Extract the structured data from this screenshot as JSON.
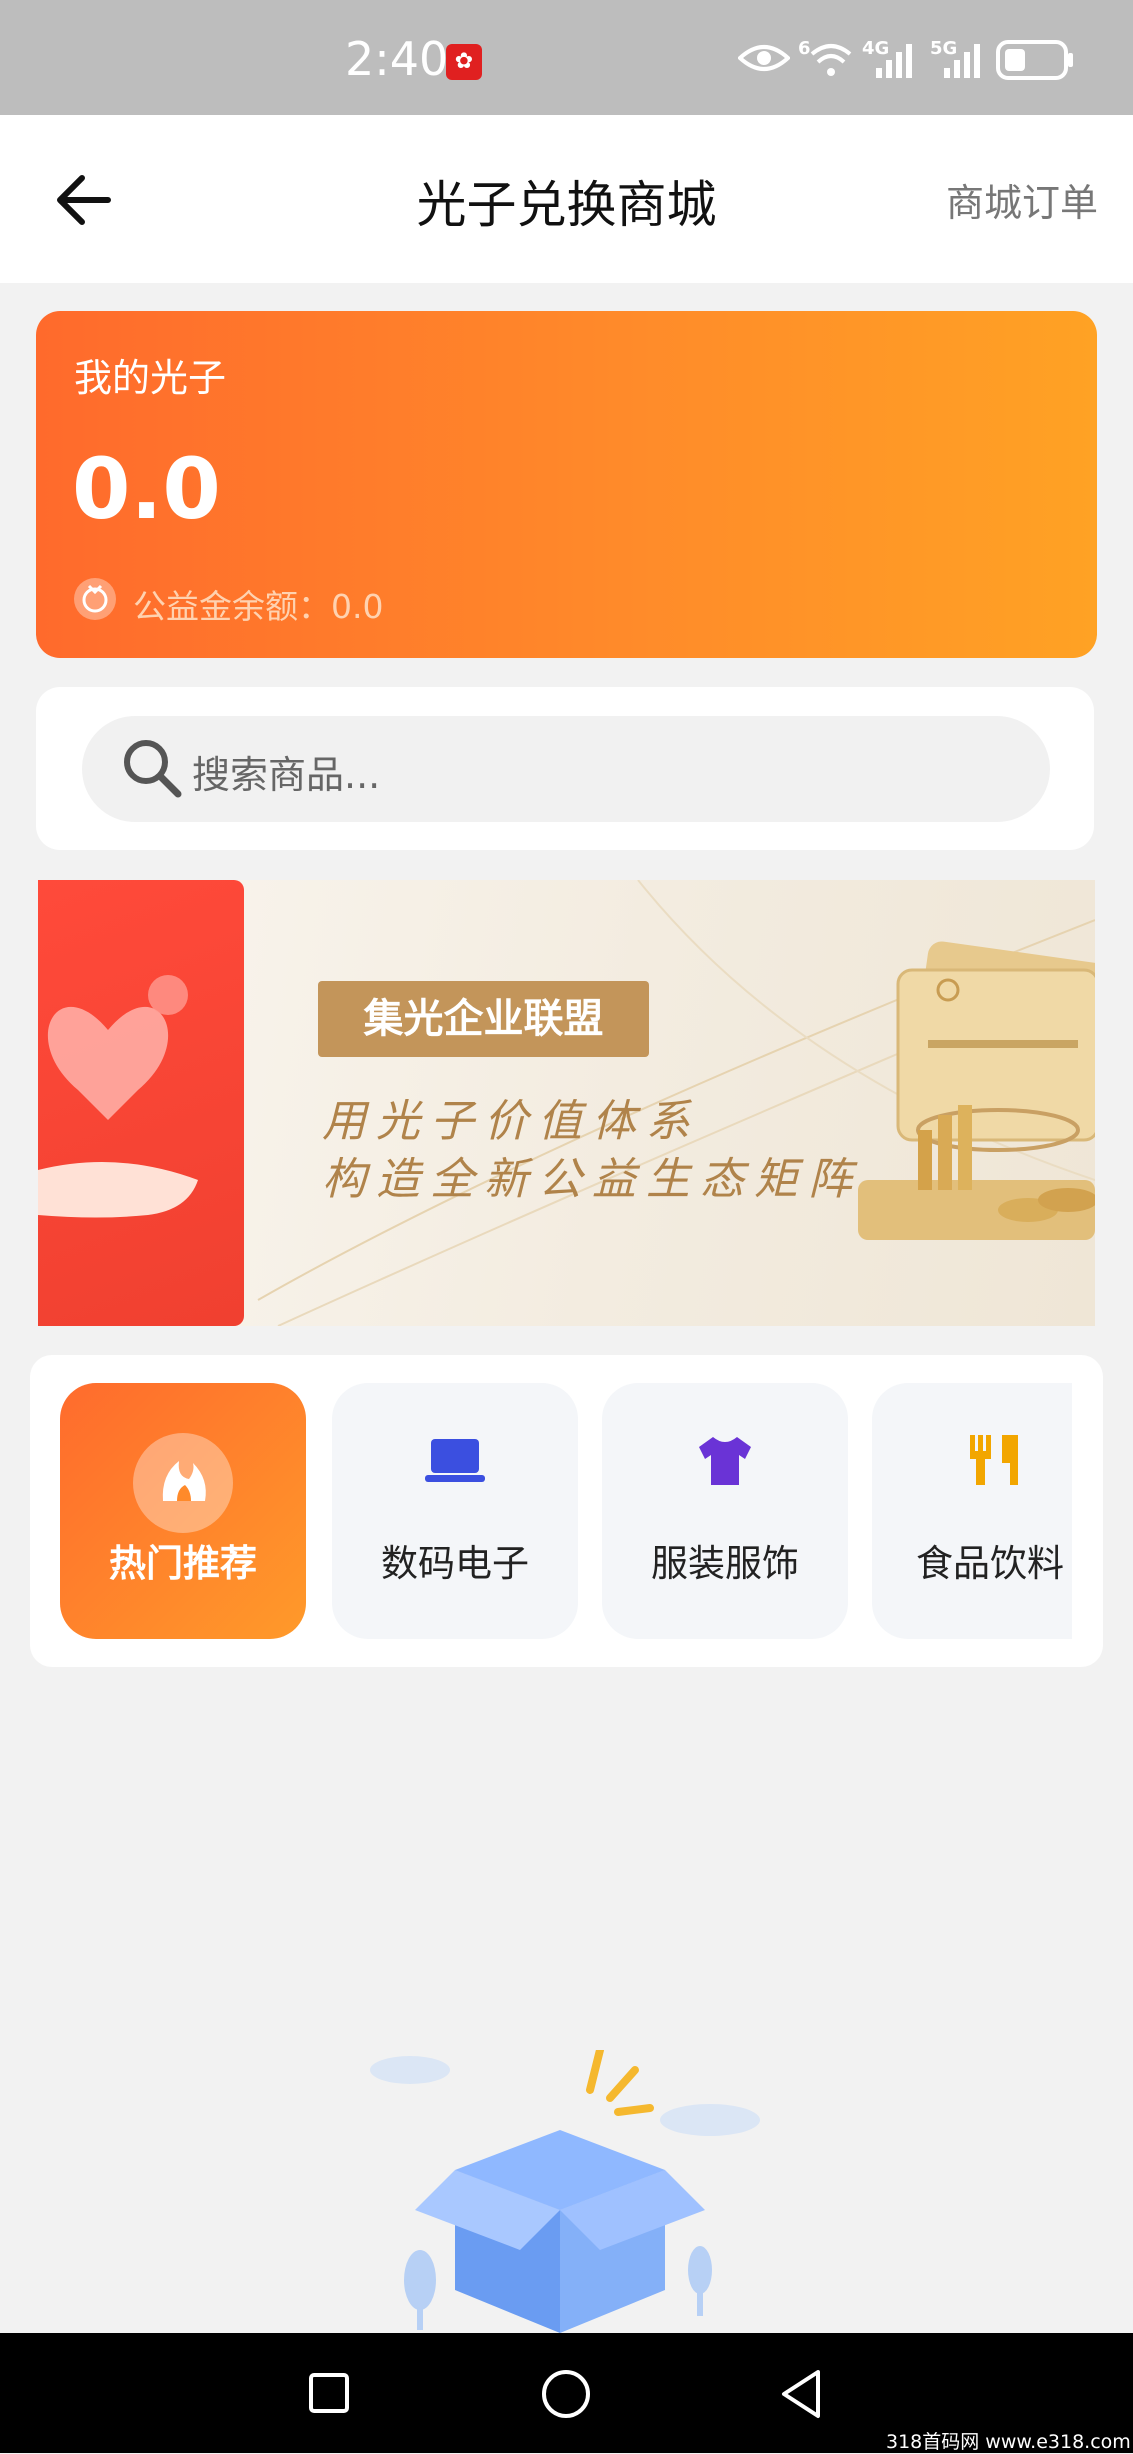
{
  "status_bar": {
    "time": "2:40",
    "net_labels": [
      "6",
      "4G",
      "5G"
    ]
  },
  "header": {
    "title": "光子兑换商城",
    "orders_link": "商城订单"
  },
  "balance": {
    "label": "我的光子",
    "value": "0.0",
    "fund_text": "公益金余额：0.0"
  },
  "search": {
    "placeholder": "搜索商品..."
  },
  "banner": {
    "tag": "集光企业联盟",
    "line1": "用光子价值体系",
    "line2": "构造全新公益生态矩阵"
  },
  "categories": [
    {
      "label": "热门推荐",
      "icon": "flame-icon",
      "active": true
    },
    {
      "label": "数码电子",
      "icon": "laptop-icon"
    },
    {
      "label": "服装服饰",
      "icon": "shirt-icon"
    },
    {
      "label": "食品饮料",
      "icon": "utensils-icon"
    }
  ],
  "watermark": "318首码网 www.e318.com",
  "colors": {
    "accent": "#ff7a2a",
    "digital_icon": "#3b4fe0",
    "clothing_icon": "#6a33d6",
    "food_icon": "#f2a600"
  }
}
